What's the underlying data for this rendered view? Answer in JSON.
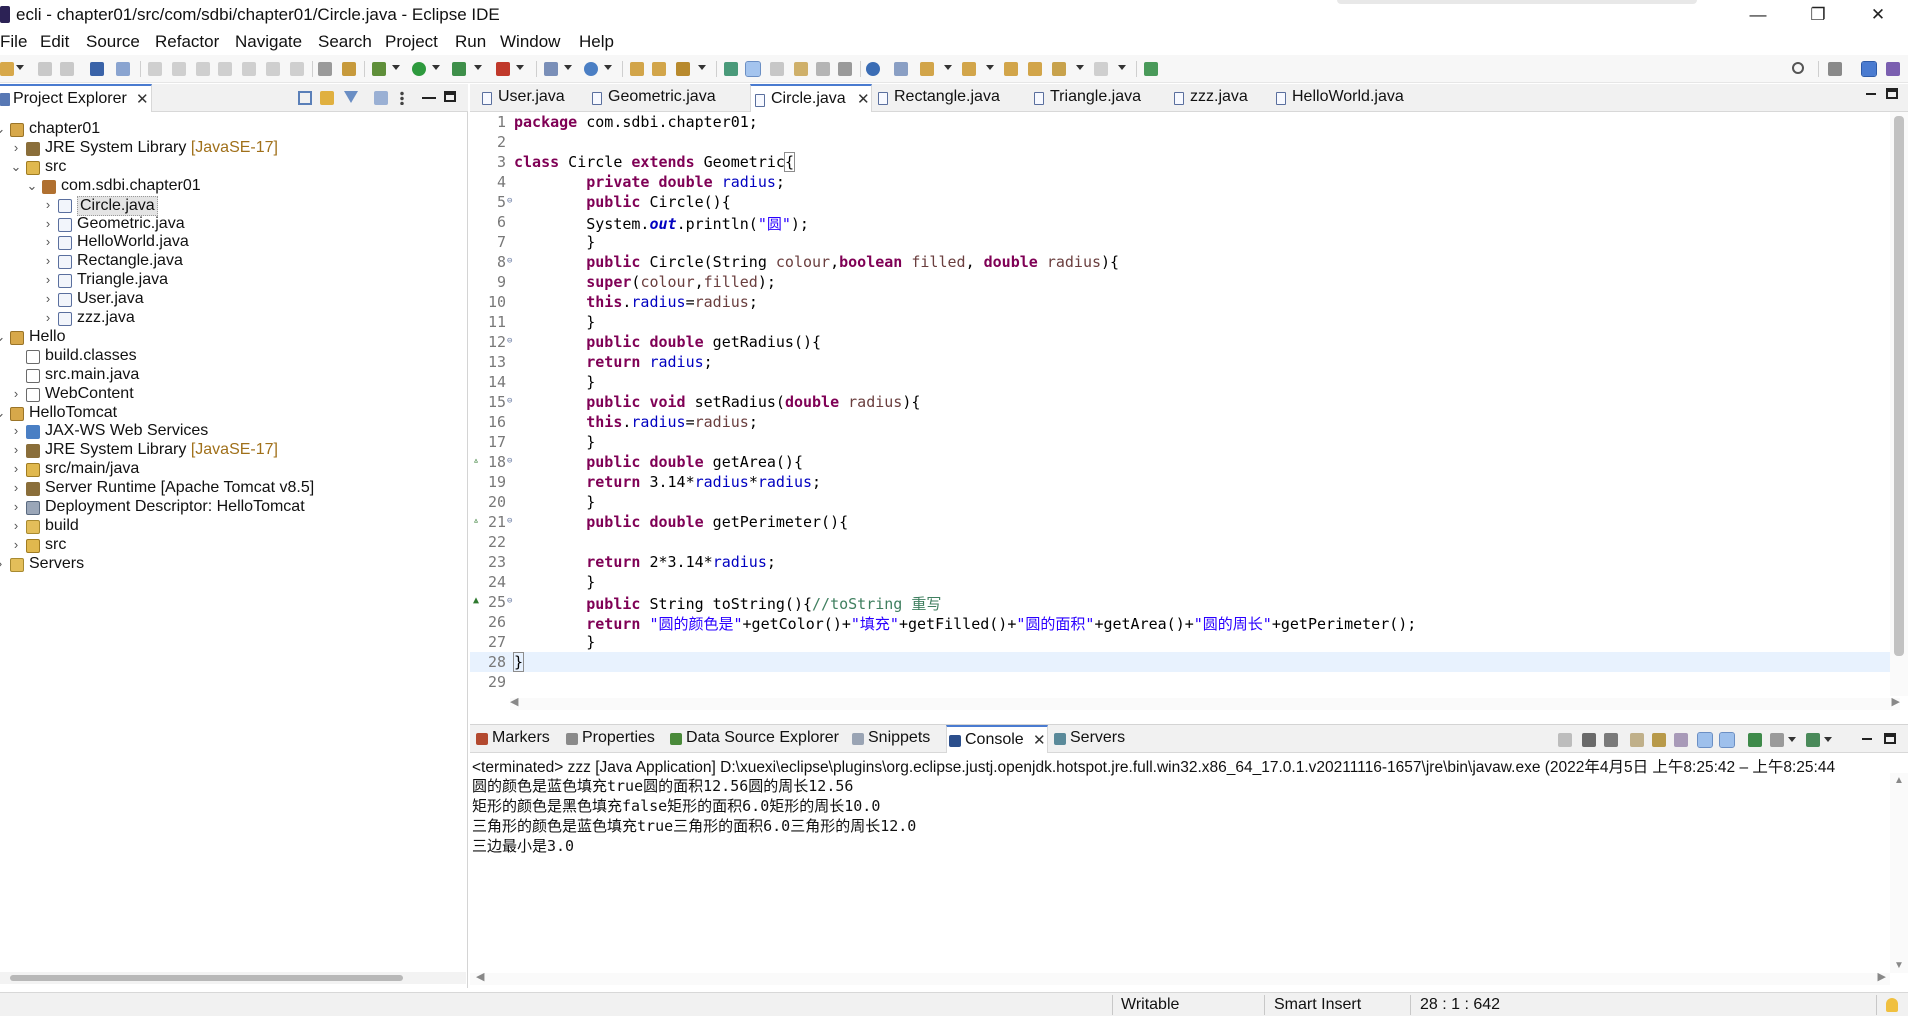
{
  "window": {
    "title": "ecli - chapter01/src/com/sdbi/chapter01/Circle.java - Eclipse IDE",
    "minimize": "—",
    "restore": "❐",
    "close": "✕"
  },
  "menu": [
    "File",
    "Edit",
    "Source",
    "Refactor",
    "Navigate",
    "Search",
    "Project",
    "Run",
    "Window",
    "Help"
  ],
  "explorer": {
    "tab_label": "Project Explorer",
    "close": "✕",
    "tree": [
      {
        "label": "chapter01",
        "deco": ""
      },
      {
        "label": "JRE System Library",
        "deco": "[JavaSE-17]"
      },
      {
        "label": "src",
        "deco": ""
      },
      {
        "label": "com.sdbi.chapter01",
        "deco": ""
      },
      {
        "label": "Circle.java",
        "deco": ""
      },
      {
        "label": "Geometric.java",
        "deco": ""
      },
      {
        "label": "HelloWorld.java",
        "deco": ""
      },
      {
        "label": "Rectangle.java",
        "deco": ""
      },
      {
        "label": "Triangle.java",
        "deco": ""
      },
      {
        "label": "User.java",
        "deco": ""
      },
      {
        "label": "zzz.java",
        "deco": ""
      },
      {
        "label": "Hello",
        "deco": ""
      },
      {
        "label": "build.classes",
        "deco": ""
      },
      {
        "label": "src.main.java",
        "deco": ""
      },
      {
        "label": "WebContent",
        "deco": ""
      },
      {
        "label": "HelloTomcat",
        "deco": ""
      },
      {
        "label": "JAX-WS Web Services",
        "deco": ""
      },
      {
        "label": "JRE System Library",
        "deco": "[JavaSE-17]"
      },
      {
        "label": "src/main/java",
        "deco": ""
      },
      {
        "label": "Server Runtime [Apache Tomcat v8.5]",
        "deco": ""
      },
      {
        "label": "Deployment Descriptor: HelloTomcat",
        "deco": ""
      },
      {
        "label": "build",
        "deco": ""
      },
      {
        "label": "src",
        "deco": ""
      },
      {
        "label": "Servers",
        "deco": ""
      }
    ]
  },
  "editor": {
    "tabs": [
      "User.java",
      "Geometric.java",
      "Circle.java",
      "Rectangle.java",
      "Triangle.java",
      "zzz.java",
      "HelloWorld.java"
    ],
    "active_tab": "Circle.java",
    "line_numbers": [
      "1",
      "2",
      "3",
      "4",
      "5",
      "6",
      "7",
      "8",
      "9",
      "10",
      "11",
      "12",
      "13",
      "14",
      "15",
      "16",
      "17",
      "18",
      "19",
      "20",
      "21",
      "22",
      "23",
      "24",
      "25",
      "26",
      "27",
      "28",
      "29"
    ],
    "code": {
      "l1_kw": "package",
      "l1_rest": " com.sdbi.chapter01;",
      "l3_kw1": "class",
      "l3_name": " Circle ",
      "l3_kw2": "extends",
      "l3_rest": " Geometric",
      "l3_brace": "{",
      "l4_kw": "private double",
      "l4_fld": "radius",
      "l4_end": ";",
      "l5_kw": "public",
      "l5_rest": " Circle(){",
      "l6_a": "System.",
      "l6_out": "out",
      "l6_b": ".println(",
      "l6_str": "\"圆\"",
      "l6_c": ");",
      "l7": "}",
      "l8_kw1": "public",
      "l8_a": " Circle(String ",
      "l8_p1": "colour",
      "l8_b": ",",
      "l8_kw2": "boolean",
      "l8_c": " ",
      "l8_p2": "filled",
      "l8_d": ", ",
      "l8_kw3": "double",
      "l8_e": " ",
      "l8_p3": "radius",
      "l8_f": "){",
      "l9_kw": "super",
      "l9_a": "(",
      "l9_p1": "colour",
      "l9_b": ",",
      "l9_p2": "filled",
      "l9_c": ");",
      "l10_kw": "this",
      "l10_a": ".",
      "l10_fld": "radius",
      "l10_b": "=",
      "l10_p": "radius",
      "l10_c": ";",
      "l11": "}",
      "l12_kw": "public double",
      "l12_rest": " getRadius(){",
      "l13_kw": "return",
      "l13_a": " ",
      "l13_fld": "radius",
      "l13_b": ";",
      "l14": "}",
      "l15_kw1": "public void",
      "l15_a": " setRadius(",
      "l15_kw2": "double",
      "l15_b": " ",
      "l15_p": "radius",
      "l15_c": "){",
      "l16_kw": "this",
      "l16_a": ".",
      "l16_fld": "radius",
      "l16_b": "=",
      "l16_p": "radius",
      "l16_c": ";",
      "l17": "}",
      "l18_kw": "public double",
      "l18_rest": " getArea(){",
      "l19_kw": "return",
      "l19_a": " 3.14*",
      "l19_f1": "radius",
      "l19_b": "*",
      "l19_f2": "radius",
      "l19_c": ";",
      "l20": "}",
      "l21_kw": "public double",
      "l21_rest": " getPerimeter(){",
      "l23_kw": "return",
      "l23_a": " 2*3.14*",
      "l23_fld": "radius",
      "l23_b": ";",
      "l24": "}",
      "l25_kw": "public",
      "l25_a": " String toString(){",
      "l25_cmt": "//toString 重写",
      "l26_kw": "return",
      "l26_a": " ",
      "l26_s1": "\"圆的颜色是\"",
      "l26_b": "+getColor()+",
      "l26_s2": "\"填充\"",
      "l26_c": "+getFilled()+",
      "l26_s3": "\"圆的面积\"",
      "l26_d": "+getArea()+",
      "l26_s4": "\"圆的周长\"",
      "l26_e": "+getPerimeter();",
      "l27": "}",
      "l28": "}"
    }
  },
  "console": {
    "tabs": [
      "Markers",
      "Properties",
      "Data Source Explorer",
      "Snippets",
      "Console",
      "Servers"
    ],
    "active_tab": "Console",
    "header": "<terminated> zzz [Java Application] D:\\xuexi\\eclipse\\plugins\\org.eclipse.justj.openjdk.hotspot.jre.full.win32.x86_64_17.0.1.v20211116-1657\\jre\\bin\\javaw.exe  (2022年4月5日 上午8:25:42 – 上午8:25:44",
    "output": [
      "圆的颜色是蓝色填充true圆的面积12.56圆的周长12.56",
      "矩形的颜色是黑色填充false矩形的面积6.0矩形的周长10.0",
      "三角形的颜色是蓝色填充true三角形的面积6.0三角形的周长12.0",
      "三边最小是3.0"
    ]
  },
  "status": {
    "writable": "Writable",
    "insert_mode": "Smart Insert",
    "position": "28 : 1 : 642"
  },
  "colors": {
    "keyword": "#7f0055",
    "field": "#0000c0",
    "string": "#2a00ff",
    "comment": "#3f7f5f",
    "parameter": "#6a3e3e",
    "active_tab_accent": "#4a7bd0",
    "current_line": "#e8f2fe"
  }
}
